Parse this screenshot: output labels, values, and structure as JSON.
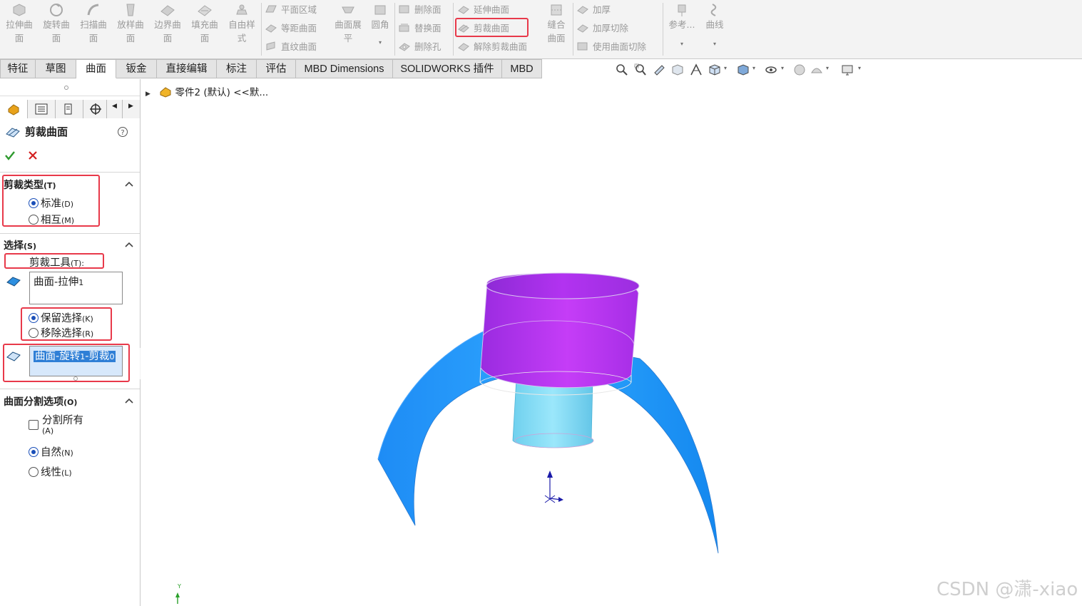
{
  "ribbon": {
    "big_buttons": [
      {
        "label": "拉伸曲\n面",
        "icon": "extrude-surface-icon"
      },
      {
        "label": "旋转曲\n面",
        "icon": "revolve-surface-icon"
      },
      {
        "label": "扫描曲\n面",
        "icon": "sweep-surface-icon"
      },
      {
        "label": "放样曲\n面",
        "icon": "loft-surface-icon"
      },
      {
        "label": "边界曲\n面",
        "icon": "boundary-surface-icon"
      },
      {
        "label": "填充曲\n面",
        "icon": "fill-surface-icon"
      },
      {
        "label": "自由样\n式",
        "icon": "freeform-icon"
      }
    ],
    "col1": [
      "平面区域",
      "等距曲面",
      "直纹曲面"
    ],
    "flatten_label": "曲面展\n平",
    "fillet_label": "圆角",
    "col2": [
      "删除面",
      "替换面",
      "删除孔"
    ],
    "col3": [
      "延伸曲面",
      "剪裁曲面",
      "解除剪裁曲面"
    ],
    "knit_label": "缝合\n曲面",
    "col4": [
      "加厚",
      "加厚切除",
      "使用曲面切除"
    ],
    "reference_label": "参考...",
    "curves_label": "曲线"
  },
  "tabs": [
    {
      "label": "特征",
      "active": false
    },
    {
      "label": "草图",
      "active": false
    },
    {
      "label": "曲面",
      "active": true
    },
    {
      "label": "钣金",
      "active": false
    },
    {
      "label": "直接编辑",
      "active": false
    },
    {
      "label": "标注",
      "active": false
    },
    {
      "label": "评估",
      "active": false
    },
    {
      "label": "MBD Dimensions",
      "active": false
    },
    {
      "label": "SOLIDWORKS 插件",
      "active": false
    },
    {
      "label": "MBD",
      "active": false
    }
  ],
  "property_manager": {
    "title": "剪裁曲面",
    "trim_type": {
      "heading": "剪裁类型",
      "heading_key": "(T)",
      "options": [
        {
          "label": "标准",
          "key": "(D)",
          "selected": true
        },
        {
          "label": "相互",
          "key": "(M)",
          "selected": false
        }
      ]
    },
    "selections": {
      "heading": "选择",
      "heading_key": "(S)",
      "trim_tool_label": "剪裁工具",
      "trim_tool_key": "(T):",
      "trim_tool_value": "曲面-拉伸",
      "trim_tool_value_sub": "1",
      "keep_options": [
        {
          "label": "保留选择",
          "key": "(K)",
          "selected": true
        },
        {
          "label": "移除选择",
          "key": "(R)",
          "selected": false
        }
      ],
      "pieces_value": "曲面-旋转",
      "pieces_value_sub1": "1",
      "pieces_value_mid": "-剪裁",
      "pieces_value_sub2": "0"
    },
    "split_options": {
      "heading": "曲面分割选项",
      "heading_key": "(O)",
      "split_all_label": "分割所有",
      "split_all_key": "(A)",
      "split_all_checked": false,
      "options": [
        {
          "label": "自然",
          "key": "(N)",
          "selected": true
        },
        {
          "label": "线性",
          "key": "(L)",
          "selected": false
        }
      ]
    }
  },
  "tree": {
    "node_label": "零件2 (默认) <<默..."
  },
  "colors": {
    "accent_blue": "#1e90ff",
    "purple": "#b233f0",
    "cyan": "#7fdcf0",
    "highlight_red": "#e8394a"
  },
  "axis_label": "Y",
  "watermark": "CSDN @潇-xiao"
}
